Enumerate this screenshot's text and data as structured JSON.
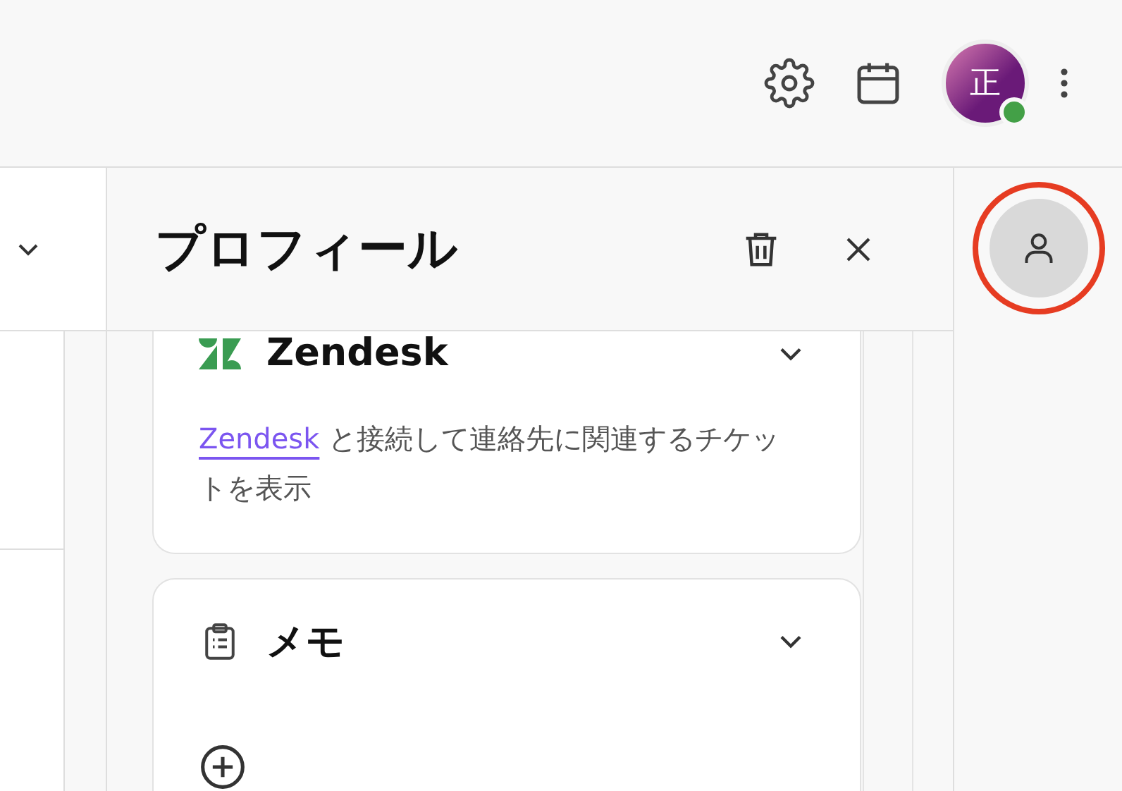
{
  "top_bar": {
    "avatar": {
      "initial": "正",
      "online": true
    }
  },
  "left_pane": {
    "expanded": false
  },
  "profile_panel": {
    "title": "プロフィール",
    "cards": [
      {
        "kind": "zendesk",
        "title": "Zendesk",
        "expanded": true,
        "link": "Zendesk",
        "text": "と接続して連絡先に関連するチケットを表示"
      },
      {
        "kind": "memo",
        "title": "メモ",
        "expanded": true
      }
    ]
  },
  "right_rail": {
    "profile_button": {
      "selected": true,
      "highlighted": true
    }
  }
}
